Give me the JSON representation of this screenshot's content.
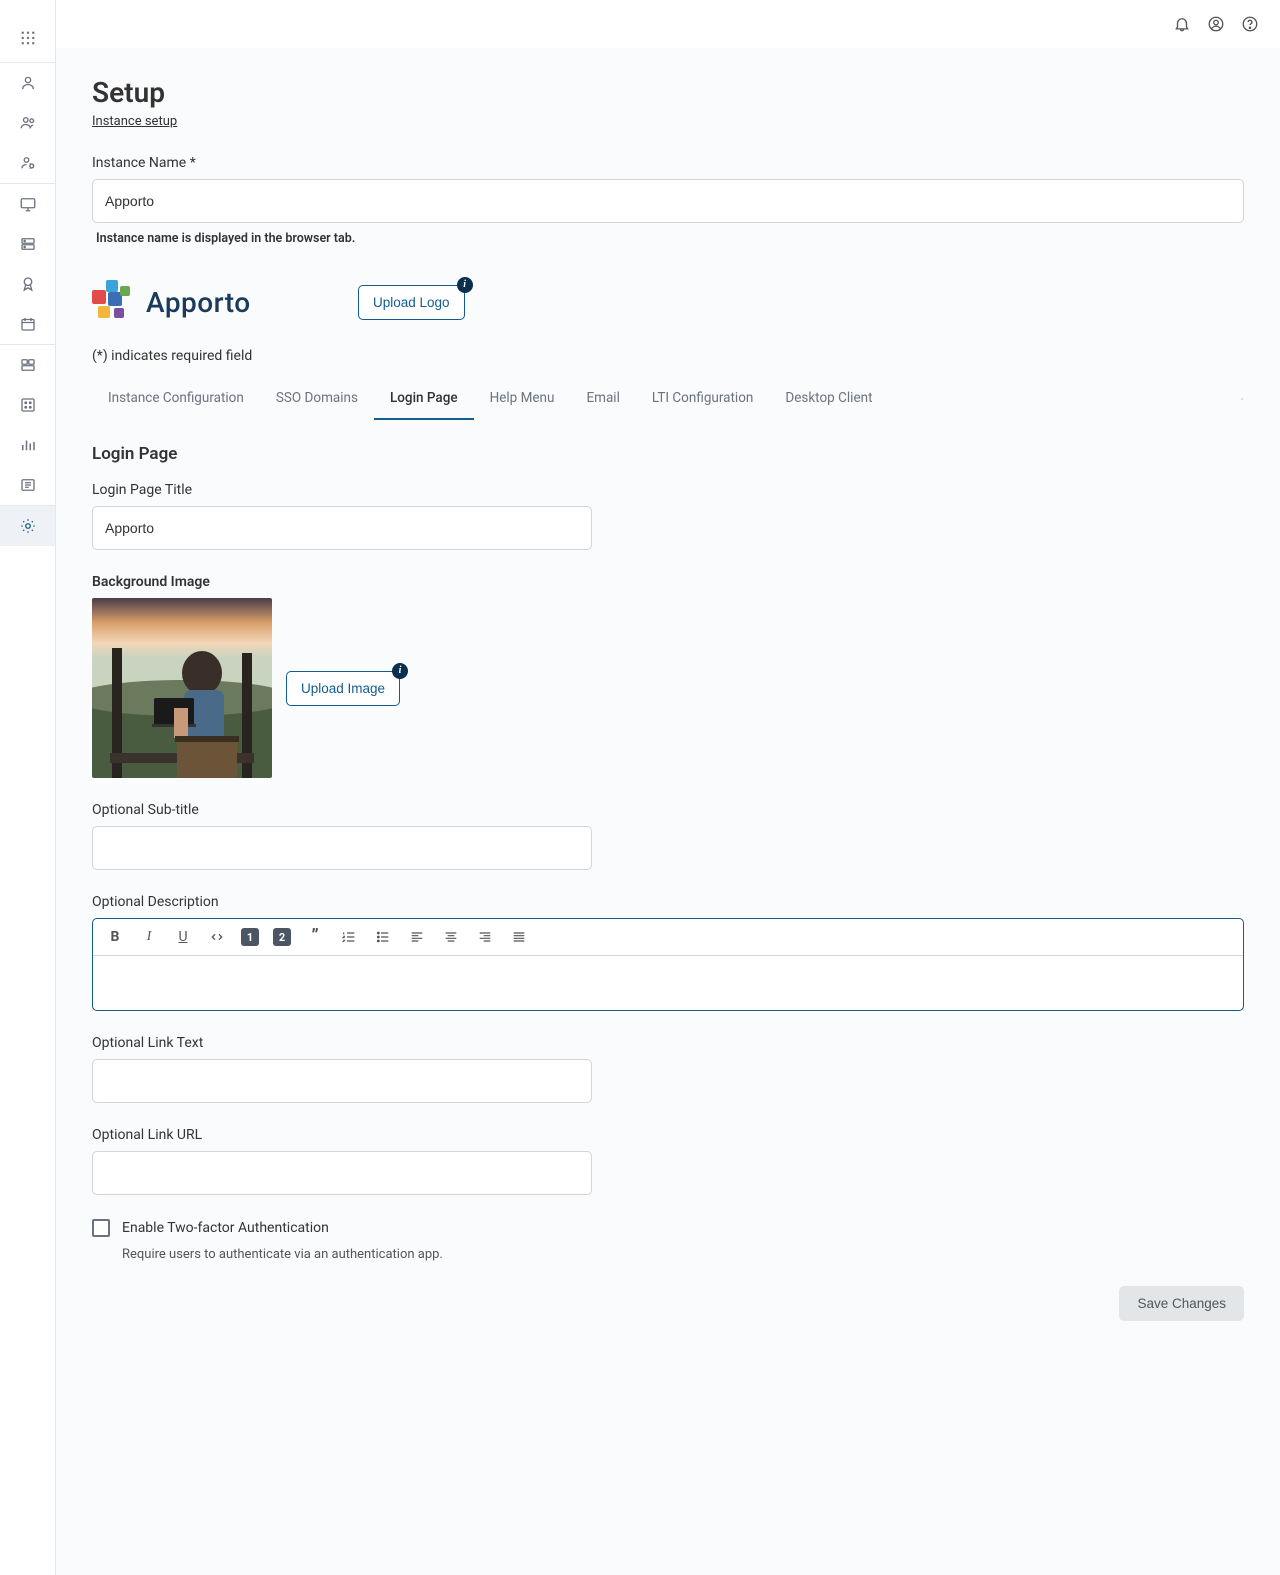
{
  "header": {
    "title": "Setup",
    "subtitle_link": "Instance setup"
  },
  "instance_name": {
    "label": "Instance Name *",
    "value": "Apporto",
    "helper": "Instance name is displayed in the browser tab."
  },
  "logo": {
    "brand_text": "Apporto",
    "upload_label": "Upload Logo"
  },
  "required_note": "(*) indicates required field",
  "tabs": [
    "Instance Configuration",
    "SSO Domains",
    "Login Page",
    "Help Menu",
    "Email",
    "LTI Configuration",
    "Desktop Client"
  ],
  "active_tab": "Login Page",
  "login_page": {
    "section_heading": "Login Page",
    "title_label": "Login Page Title",
    "title_value": "Apporto",
    "bg_label": "Background Image",
    "bg_upload_label": "Upload Image",
    "subtitle_label": "Optional Sub-title",
    "subtitle_value": "",
    "description_label": "Optional Description",
    "description_value": "",
    "link_text_label": "Optional Link Text",
    "link_text_value": "",
    "link_url_label": "Optional Link URL",
    "link_url_value": "",
    "twofa_label": "Enable Two-factor Authentication",
    "twofa_checked": false,
    "twofa_help": "Require users to authenticate via an authentication app."
  },
  "save_label": "Save Changes",
  "info_badge": "i",
  "rte_badges": {
    "h1": "1",
    "h2": "2"
  }
}
